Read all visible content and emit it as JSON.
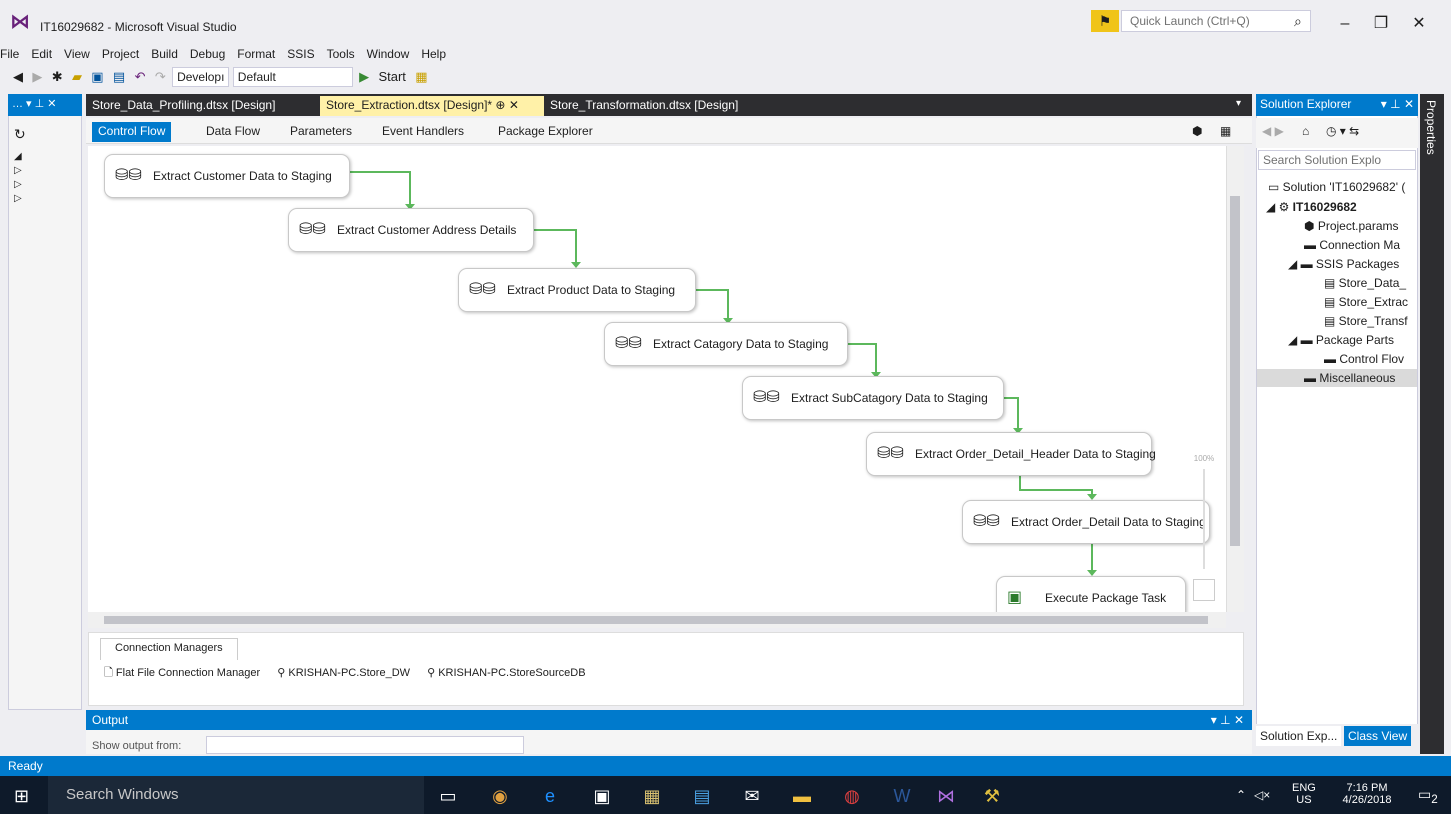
{
  "window": {
    "title": "IT16029682 - Microsoft Visual Studio",
    "quick_launch_placeholder": "Quick Launch (Ctrl+Q)"
  },
  "menu": [
    "File",
    "Edit",
    "View",
    "Project",
    "Build",
    "Debug",
    "Format",
    "SSIS",
    "Tools",
    "Window",
    "Help"
  ],
  "toolbar": {
    "config": "Developı",
    "platform": "Default",
    "start": "Start"
  },
  "doc_tabs": [
    {
      "label": "Store_Data_Profiling.dtsx [Design]",
      "active": false
    },
    {
      "label": "Store_Extraction.dtsx [Design]*",
      "active": true
    },
    {
      "label": "Store_Transformation.dtsx [Design]",
      "active": false
    }
  ],
  "designer_tabs": [
    "Control Flow",
    "Data Flow",
    "Parameters",
    "Event Handlers",
    "Package Explorer"
  ],
  "tasks": [
    "Extract Customer Data to Staging",
    "Extract Customer Address Details",
    "Extract Product Data to Staging",
    "Extract Catagory Data to Staging",
    "Extract SubCatagory Data to Staging",
    "Extract Order_Detail_Header Data to Staging",
    "Extract Order_Detail Data to Staging",
    "Execute Package Task"
  ],
  "zoom": "100%",
  "connection_managers": {
    "tab": "Connection Managers",
    "items": [
      "Flat File Connection Manager",
      "KRISHAN-PC.Store_DW",
      "KRISHAN-PC.StoreSourceDB"
    ]
  },
  "output": {
    "title": "Output",
    "label": "Show output from:"
  },
  "solution_explorer": {
    "title": "Solution Explorer",
    "search_placeholder": "Search Solution Explo",
    "nodes": [
      {
        "label": "Solution 'IT16029682' (",
        "indent": 0
      },
      {
        "label": "IT16029682",
        "indent": 1
      },
      {
        "label": "Project.params",
        "indent": 2
      },
      {
        "label": "Connection Ma",
        "indent": 2
      },
      {
        "label": "SSIS Packages",
        "indent": 2
      },
      {
        "label": "Store_Data_",
        "indent": 3
      },
      {
        "label": "Store_Extrac",
        "indent": 3
      },
      {
        "label": "Store_Transf",
        "indent": 3
      },
      {
        "label": "Package Parts",
        "indent": 2
      },
      {
        "label": "Control Flov",
        "indent": 3
      },
      {
        "label": "Miscellaneous",
        "indent": 2
      }
    ],
    "bottom_tabs": [
      "Solution Exp...",
      "Class View"
    ]
  },
  "properties_label": "Properties",
  "status": "Ready",
  "taskbar": {
    "search": "Search Windows",
    "lang1": "ENG",
    "lang2": "US",
    "time": "7:16 PM",
    "date": "4/26/2018",
    "notif_count": "2"
  },
  "colors": {
    "accent": "#007acc",
    "active_tab": "#fff1a8",
    "flow_line": "#5cb85c",
    "dark_tab": "#2d2d30"
  }
}
